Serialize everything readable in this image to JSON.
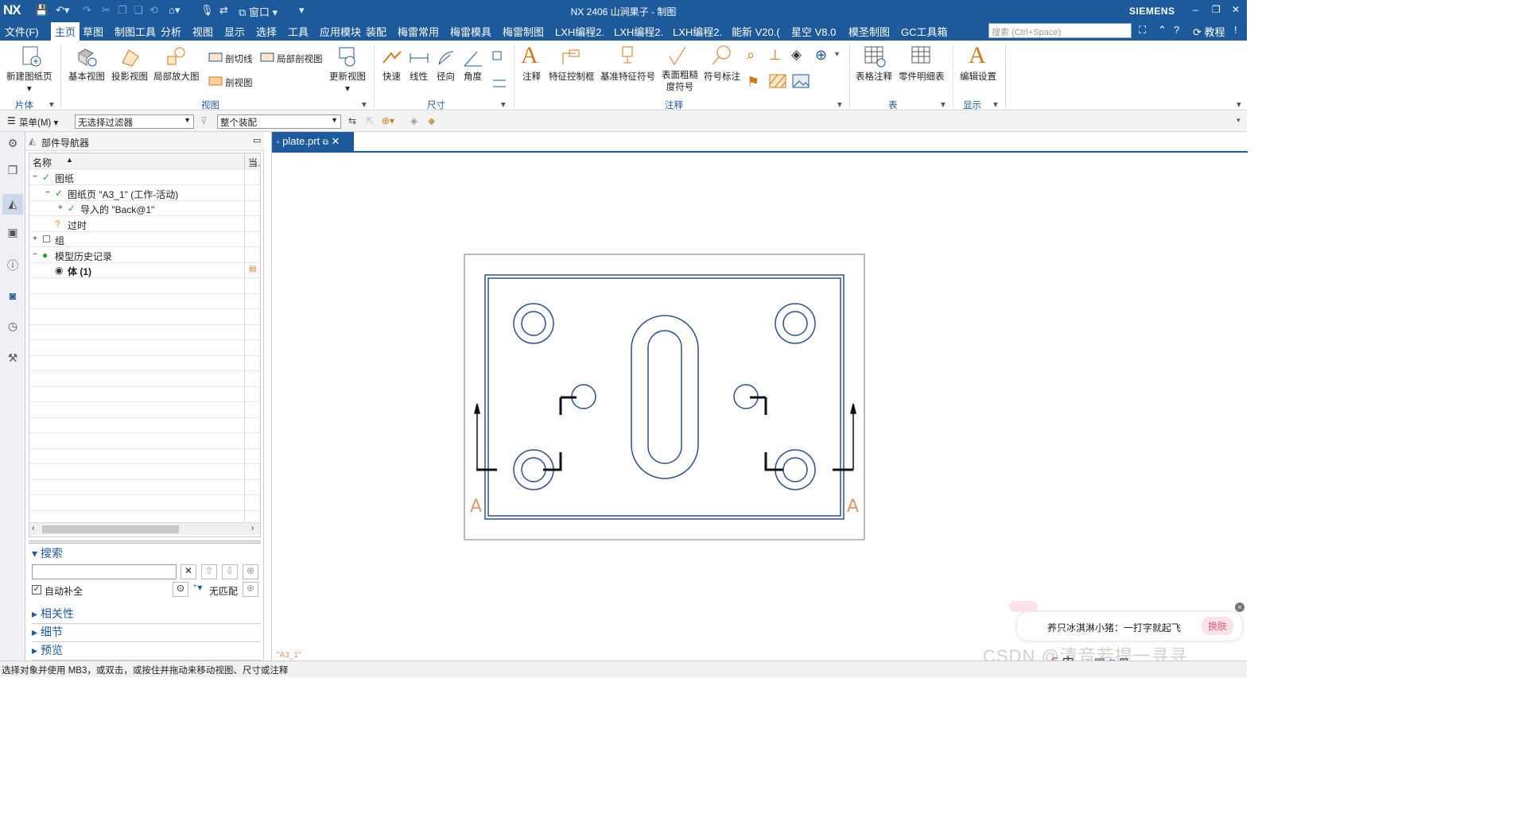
{
  "titlebar": {
    "logo": "NX",
    "title": "NX 2406 山涧果子 - 制图",
    "brand": "SIEMENS",
    "window_menu": "窗口"
  },
  "menubar": {
    "tabs": [
      "文件(F)",
      "主页",
      "草图",
      "制图工具",
      "分析",
      "视图",
      "显示",
      "选择",
      "工具",
      "应用模块",
      "装配",
      "梅雷常用",
      "梅雷模具",
      "梅雷制图",
      "LXH编程2.",
      "LXH编程2.",
      "LXH编程2.",
      "能新 V20.(",
      "星空 V8.0",
      "模圣制图",
      "GC工具箱"
    ],
    "active_index": 1,
    "search_placeholder": "搜索 (Ctrl+Space)",
    "tutorial": "教程"
  },
  "ribbon": {
    "sheet": {
      "new_sheet": "新建图纸页",
      "group": "片体"
    },
    "view": {
      "base": "基本视图",
      "projected": "投影视图",
      "detail": "局部放大图",
      "section_line": "剖切线",
      "break_out": "局部剖视图",
      "section": "剖视图",
      "update": "更新视图",
      "group": "视图"
    },
    "dimension": {
      "rapid": "快速",
      "linear": "线性",
      "radial": "径向",
      "angular": "角度",
      "group": "尺寸"
    },
    "annotation": {
      "note": "注释",
      "fcf": "特征控制框",
      "datum": "基准特征符号",
      "surface_finish": "表面粗糙\n度符号",
      "balloon": "符号标注",
      "group": "注释"
    },
    "table": {
      "tabular_note": "表格注释",
      "parts_list": "零件明细表",
      "group": "表"
    },
    "display": {
      "edit_settings": "编辑设置",
      "group": "显示"
    }
  },
  "toolbar": {
    "menu": "菜单(M)",
    "filter": "无选择过滤器",
    "scope": "整个装配"
  },
  "navigator": {
    "title": "部件导航器",
    "col_name": "名称",
    "col_current": "当.",
    "rows": [
      {
        "label": "图纸",
        "indent": 0,
        "icon": "check"
      },
      {
        "label": "图纸页 \"A3_1\" (工作-活动)",
        "indent": 1,
        "icon": "check"
      },
      {
        "label": "导入的 \"Back@1\"",
        "indent": 2,
        "icon": "check"
      },
      {
        "label": "过时",
        "indent": 1,
        "icon": "question"
      },
      {
        "label": "组",
        "indent": 0,
        "icon": "box"
      },
      {
        "label": "模型历史记录",
        "indent": 0,
        "icon": "green"
      },
      {
        "label": "体 (1)",
        "indent": 1,
        "icon": "eye"
      }
    ]
  },
  "search": {
    "title": "搜索",
    "autocomplete": "自动补全",
    "nomatch": "无匹配",
    "sections": [
      "相关性",
      "细节",
      "预览"
    ]
  },
  "document": {
    "tab": "plate.prt",
    "sheet_label": "\"A3_1\""
  },
  "drawing": {
    "section_label_left": "A",
    "section_label_right": "A"
  },
  "statusbar": {
    "message": "选择对象并使用 MB3，或双击，或按住并拖动来移动视图、尺寸或注释"
  },
  "popup": {
    "text": "养只冰淇淋小猪：一打字就起飞",
    "button": "换肤"
  },
  "watermark": "CSDN @清音若提一寻寻",
  "colors": {
    "accent": "#1d5a9c",
    "drawing_lines": "#2a4f8f",
    "section_label": "#d99a6c"
  }
}
